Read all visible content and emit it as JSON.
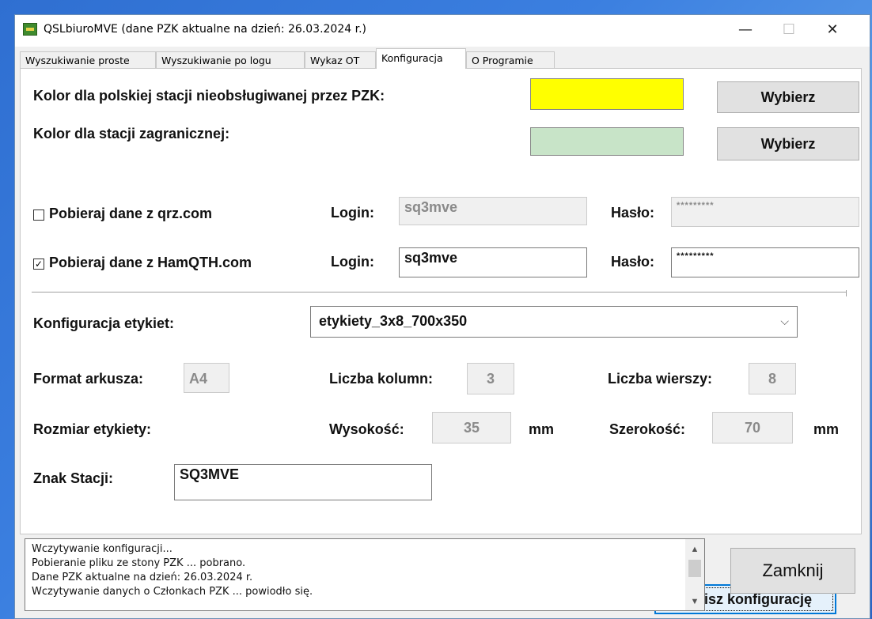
{
  "window": {
    "title": "QSLbiuroMVE (dane PZK aktualne na dzień: 26.03.2024 r.)",
    "controls": {
      "minimize": "—",
      "maximize": "☐",
      "close": "✕"
    }
  },
  "tabs": [
    {
      "label": "Wyszukiwanie proste"
    },
    {
      "label": "Wyszukiwanie po logu"
    },
    {
      "label": "Wykaz OT"
    },
    {
      "label": "Konfiguracja"
    },
    {
      "label": "O Programie"
    }
  ],
  "active_tab": "Konfiguracja",
  "colors": {
    "polish_label": "Kolor dla polskiej stacji nieobsługiwanej przez PZK:",
    "polish_color": "#ffff00",
    "foreign_label": "Kolor dla stacji zagranicznej:",
    "foreign_color": "#c8e4c8",
    "choose_label": "Wybierz"
  },
  "qrz": {
    "checkbox_label": "Pobieraj dane z qrz.com",
    "checked": false,
    "login_label": "Login:",
    "login_value": "sq3mve",
    "password_label": "Hasło:",
    "password_value": "*********"
  },
  "hamqth": {
    "checkbox_label": "Pobieraj dane z HamQTH.com",
    "checked": true,
    "check_glyph": "✓",
    "login_label": "Login:",
    "login_value": "sq3mve",
    "password_label": "Hasło:",
    "password_value": "*********"
  },
  "labels_config": {
    "label": "Konfiguracja etykiet:",
    "selected": "etykiety_3x8_700x350",
    "arrow": "⌵",
    "sheet_format_label": "Format arkusza:",
    "sheet_format_value": "A4",
    "columns_label": "Liczba kolumn:",
    "columns_value": "3",
    "rows_label": "Liczba wierszy:",
    "rows_value": "8",
    "label_size_label": "Rozmiar etykiety:",
    "height_label": "Wysokość:",
    "height_value": "35",
    "width_label": "Szerokość:",
    "width_value": "70",
    "unit": "mm"
  },
  "station": {
    "label": "Znak Stacji:",
    "value": "SQ3MVE"
  },
  "save_button": "Zapisz konfigurację",
  "log": {
    "lines": [
      "Wczytywanie konfiguracji...",
      "Pobieranie pliku ze stony PZK ... pobrano.",
      "Dane PZK aktualne na dzień: 26.03.2024 r.",
      "Wczytywanie danych o Członkach PZK ... powiodło się."
    ]
  },
  "close_button": "Zamknij"
}
